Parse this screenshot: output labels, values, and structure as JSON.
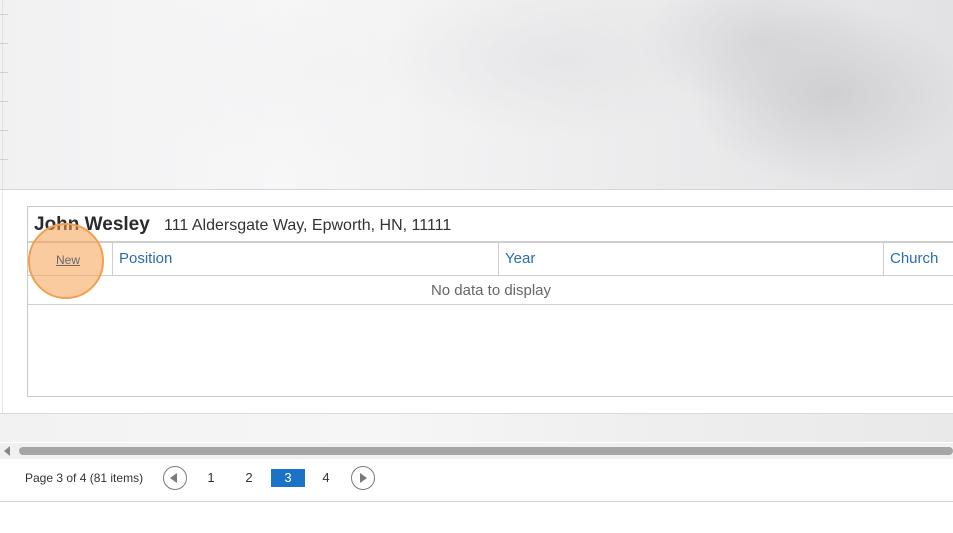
{
  "detail": {
    "name": "John Wesley",
    "address": "111 Aldersgate Way, Epworth, HN, 11111",
    "columns": {
      "new": "New",
      "position": "Position",
      "year": "Year",
      "church": "Church"
    },
    "empty_text": "No data to display"
  },
  "pager": {
    "info": "Page 3 of 4 (81 items)",
    "pages": [
      "1",
      "2",
      "3",
      "4"
    ],
    "current_page": "3",
    "prev_icon": "chevron-left-circle-icon",
    "next_icon": "chevron-right-circle-icon"
  },
  "colors": {
    "accent": "#1a73c7",
    "link": "#2a6cb0",
    "highlight": "#f0a050"
  }
}
